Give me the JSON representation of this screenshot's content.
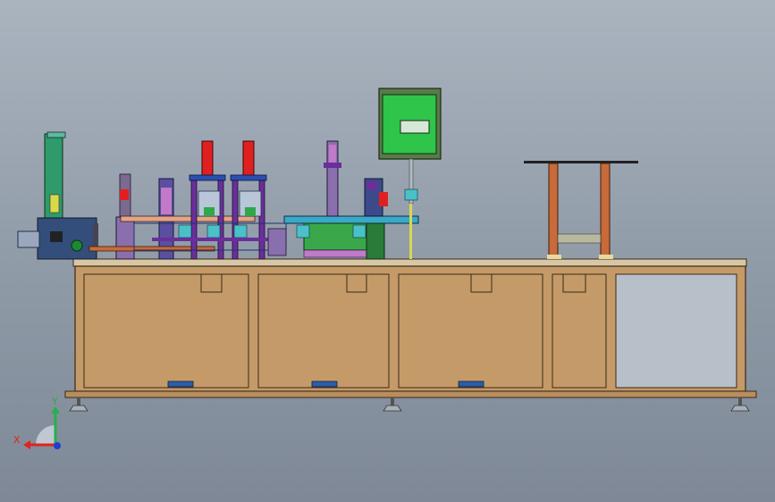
{
  "view": {
    "background_top": "#aab4bf",
    "background_bottom": "#7e8896"
  },
  "triad": {
    "x_label": "X",
    "y_label": "Y",
    "x_color": "#e0231c",
    "y_color": "#22b14c",
    "z_color": "#1f3fd1"
  },
  "colors": {
    "table_wood": "#c49a68",
    "table_edge": "#5a3e22",
    "control_box": "#2fc44a",
    "cylinder_red": "#e02020",
    "frame_purple": "#6a2f9a",
    "frame_blue": "#2a4fb0",
    "frame_green": "#3aa84a",
    "rail_copper": "#c86a3a",
    "leveling_foot": "#a8b0bb"
  }
}
